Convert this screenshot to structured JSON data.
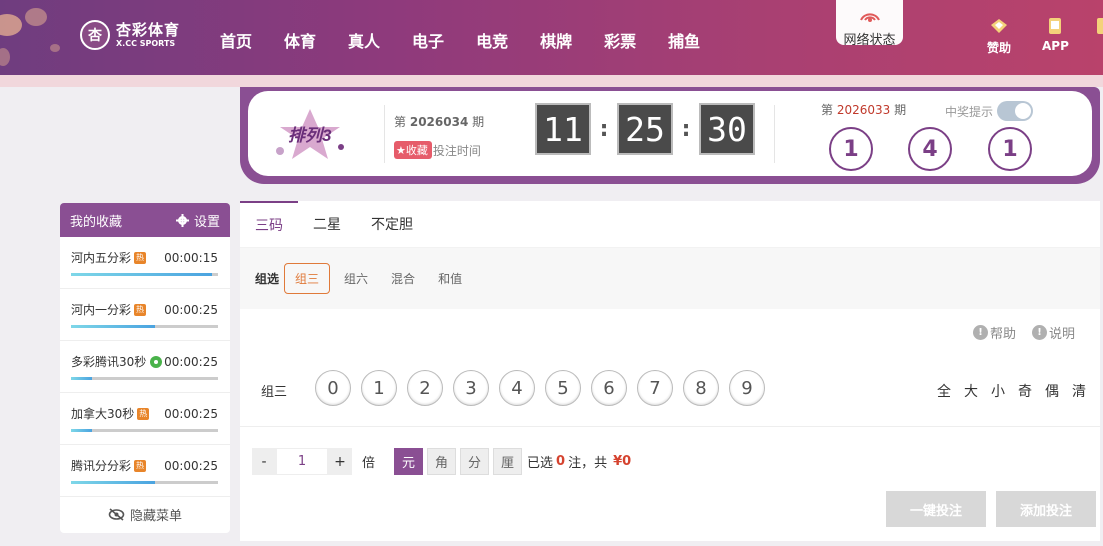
{
  "header": {
    "logo_cn": "杏彩体育",
    "logo_en": "X.CC SPORTS",
    "nav": [
      "首页",
      "体育",
      "真人",
      "电子",
      "电竞",
      "棋牌",
      "彩票",
      "捕鱼"
    ],
    "network_status": "网络状态",
    "sponsor": "赞助",
    "app": "APP"
  },
  "lottery": {
    "name": "排列3",
    "issue_prefix": "第",
    "issue_number": "2026034",
    "issue_suffix": "期",
    "favorite_label": "收藏",
    "deadline_label": "投注时间",
    "timer": {
      "hours": "11",
      "minutes": "25",
      "seconds": "30"
    },
    "prev_issue_prefix": "第",
    "prev_issue_number": "2026033",
    "prev_issue_suffix": "期",
    "notice_label": "中奖提示",
    "notice_enabled": true,
    "results": [
      "1",
      "4",
      "1"
    ]
  },
  "sidebar": {
    "title": "我的收藏",
    "settings": "设置",
    "items": [
      {
        "name": "河内五分彩",
        "badge": "热",
        "time": "00:00:15",
        "progress": 0.96
      },
      {
        "name": "河内一分彩",
        "badge": "热",
        "time": "00:00:25",
        "progress": 0.57
      },
      {
        "name": "多彩腾讯30秒",
        "badge": "gear",
        "time": "00:00:25",
        "progress": 0.14
      },
      {
        "name": "加拿大30秒",
        "badge": "热",
        "time": "00:00:25",
        "progress": 0.14
      },
      {
        "name": "腾讯分分彩",
        "badge": "热",
        "time": "00:00:25",
        "progress": 0.57
      }
    ],
    "hide_menu": "隐藏菜单"
  },
  "main": {
    "tabs": [
      "三码",
      "二星",
      "不定胆"
    ],
    "subtab_label": "组选",
    "subtabs": [
      "组三",
      "组六",
      "混合",
      "和值"
    ],
    "help": "帮助",
    "explain": "说明",
    "row_label": "组三",
    "numbers": [
      "0",
      "1",
      "2",
      "3",
      "4",
      "5",
      "6",
      "7",
      "8",
      "9"
    ],
    "quick": [
      "全",
      "大",
      "小",
      "奇",
      "偶",
      "清"
    ],
    "multiplier": "1",
    "multiplier_label": "倍",
    "units": [
      "元",
      "角",
      "分",
      "厘"
    ],
    "selected_prefix": "已选",
    "selected_count": "0",
    "selected_mid": "注，共",
    "total": "¥0",
    "one_click_bet": "一键投注",
    "add_bet": "添加投注"
  },
  "colors": {
    "brand": "#8a4f93",
    "accent": "#e07a3a",
    "hot": "#e8852a"
  }
}
